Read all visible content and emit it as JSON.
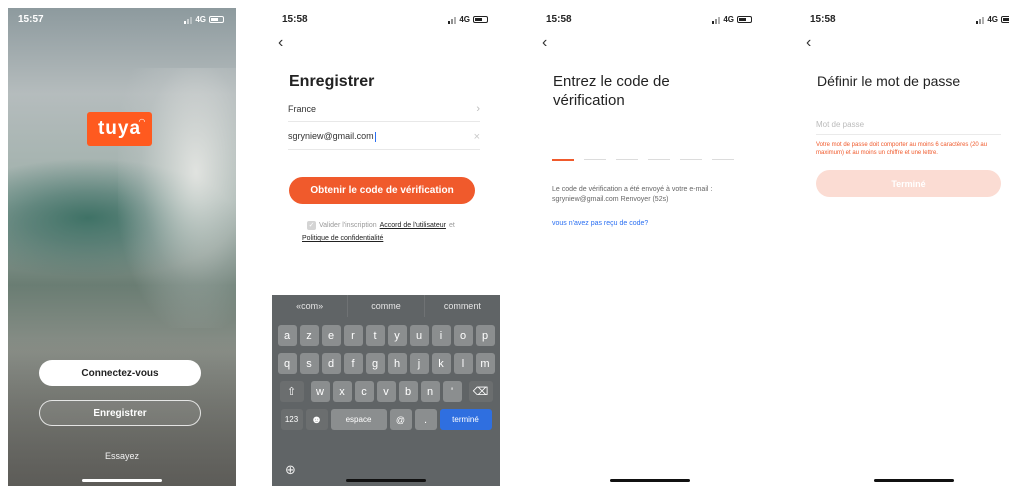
{
  "screen1": {
    "time": "15:57",
    "network": "4G",
    "logo_text": "tuya",
    "login_button": "Connectez-vous",
    "register_button": "Enregistrer",
    "try_link": "Essayez"
  },
  "screen2": {
    "time": "15:58",
    "network": "4G",
    "title": "Enregistrer",
    "country": "France",
    "email_value": "sgryniew@gmail.com",
    "get_code_button": "Obtenir le code de vérification",
    "agree_prefix": "Valider l'inscription",
    "agreement_link": "Accord de l'utilisateur",
    "agree_suffix": "et",
    "policy_link": "Politique de confidentialité",
    "keyboard": {
      "suggestions": [
        "«com»",
        "comme",
        "comment"
      ],
      "row1": [
        "a",
        "z",
        "e",
        "r",
        "t",
        "y",
        "u",
        "i",
        "o",
        "p"
      ],
      "row2": [
        "q",
        "s",
        "d",
        "f",
        "g",
        "h",
        "j",
        "k",
        "l",
        "m"
      ],
      "row3": [
        "w",
        "x",
        "c",
        "v",
        "b",
        "n",
        "'"
      ],
      "num_key": "123",
      "space_key": "espace",
      "at_key": "@",
      "dot_key": ".",
      "done_key": "terminé"
    }
  },
  "screen3": {
    "time": "15:58",
    "network": "4G",
    "title": "Entrez le code de vérification",
    "info_line1": "Le code de vérification a été envoyé à votre e-mail :",
    "info_line2": "sgryniew@gmail.com Renvoyer (52s)",
    "not_received_link": "vous n'avez pas reçu de code?"
  },
  "screen4": {
    "time": "15:58",
    "network": "4G",
    "title": "Définir le mot de passe",
    "password_placeholder": "Mot de passe",
    "password_hint": "Votre mot de passe doit comporter au moins 6 caractères (20 au maximum) et au moins un chiffre et une lettre.",
    "done_button": "Terminé"
  },
  "colors": {
    "accent": "#f05a2c",
    "link": "#2a6ff2",
    "logo": "#ff5a1f"
  }
}
